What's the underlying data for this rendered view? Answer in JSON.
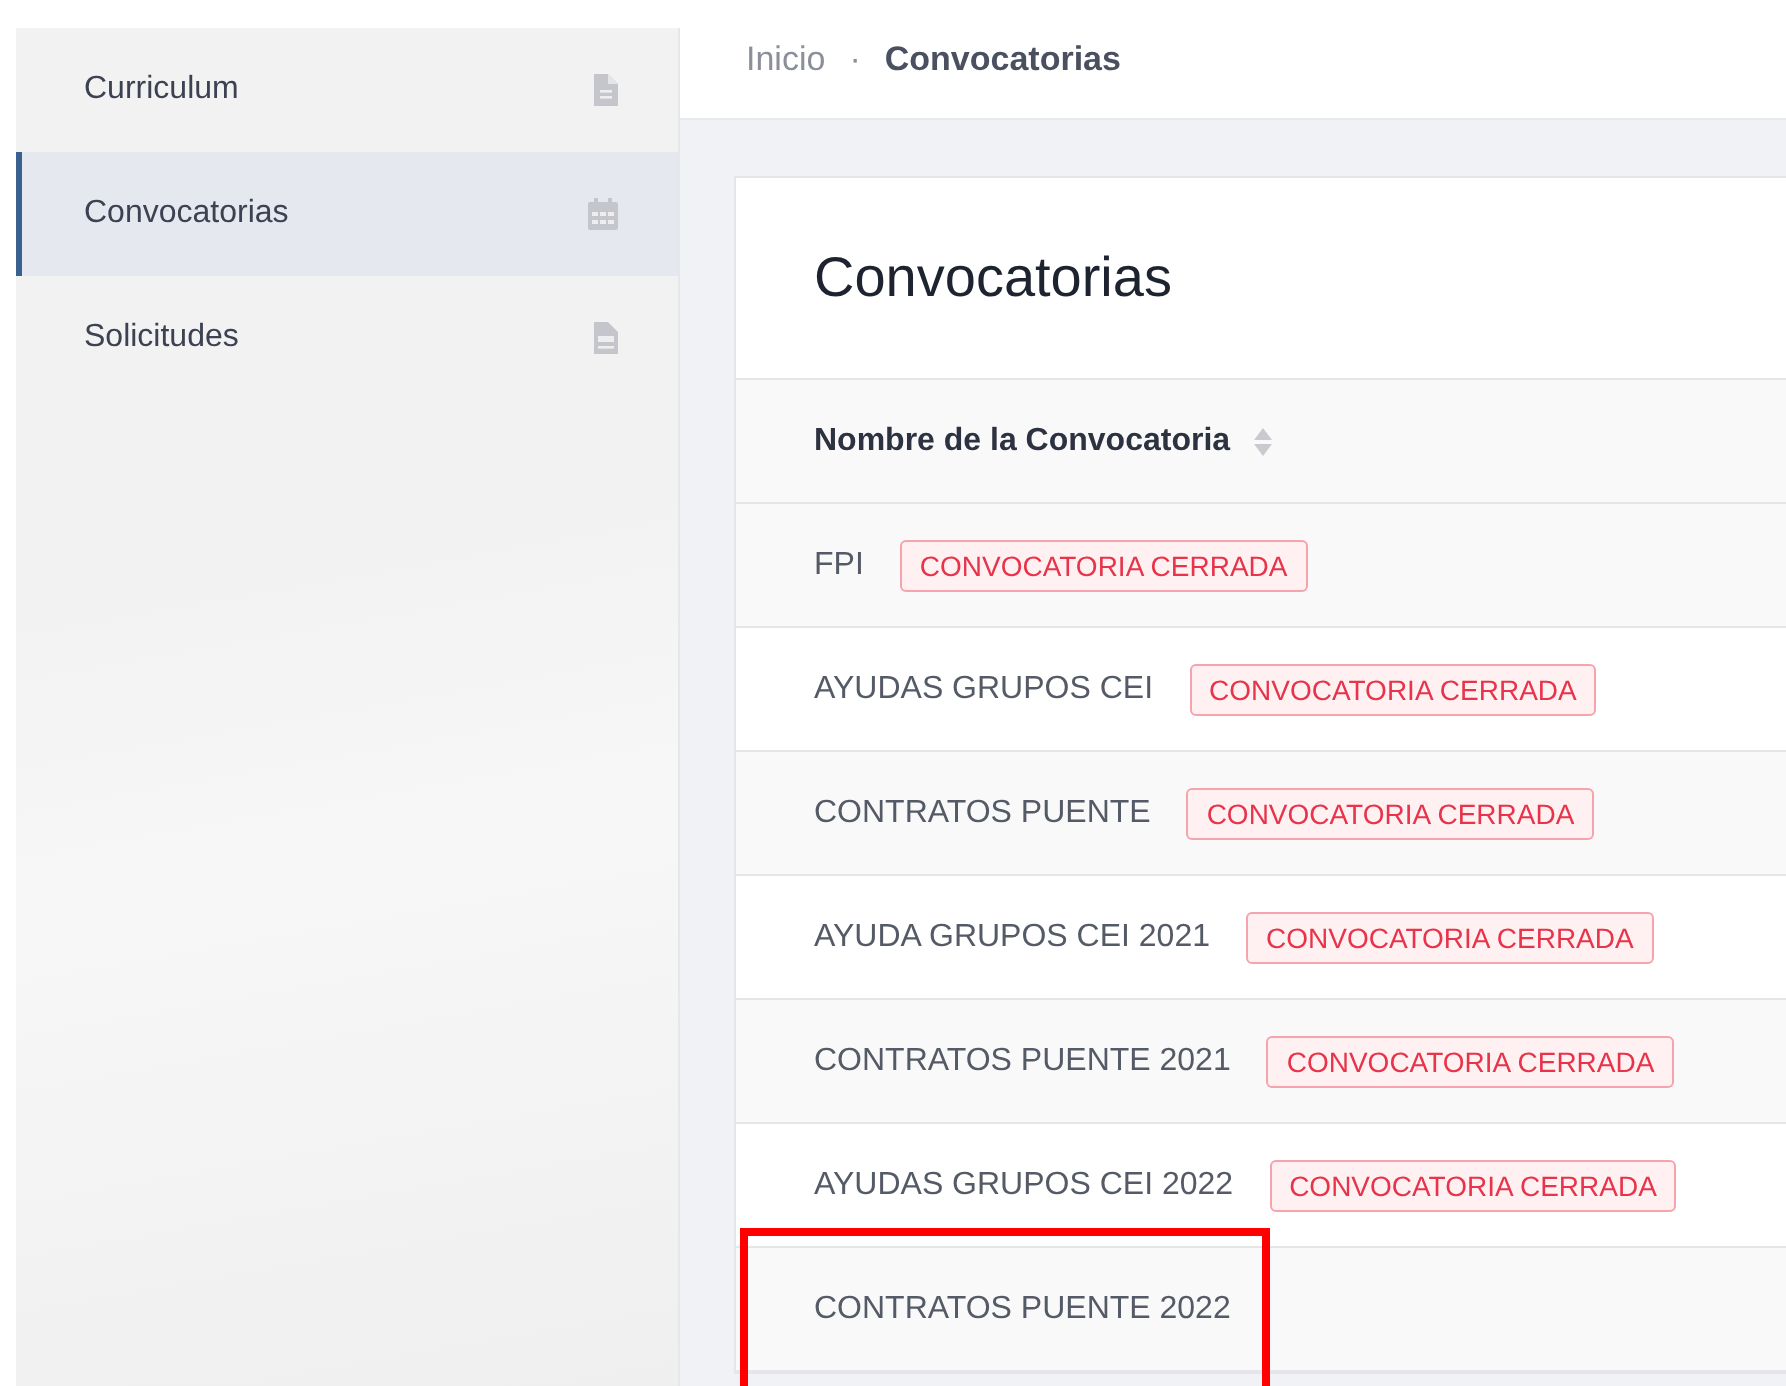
{
  "sidebar": {
    "items": [
      {
        "label": "Curriculum",
        "kind": "document",
        "selected": false
      },
      {
        "label": "Convocatorias",
        "kind": "calendar",
        "selected": true
      },
      {
        "label": "Solicitudes",
        "kind": "form",
        "selected": false
      }
    ]
  },
  "breadcrumb": [
    {
      "label": "Inicio",
      "current": false
    },
    {
      "label": "Convocatorias",
      "current": true
    }
  ],
  "breadcrumb_separator": "·",
  "card": {
    "title": "Convocatorias",
    "table": {
      "columns": [
        {
          "label": "Nombre de la Convocatoria",
          "sortable": true
        }
      ],
      "rows": [
        {
          "name": "FPI",
          "badge": "CONVOCATORIA CERRADA",
          "highlighted": false
        },
        {
          "name": "AYUDAS GRUPOS CEI",
          "badge": "CONVOCATORIA CERRADA",
          "highlighted": false
        },
        {
          "name": "CONTRATOS PUENTE",
          "badge": "CONVOCATORIA CERRADA",
          "highlighted": false
        },
        {
          "name": "AYUDA GRUPOS CEI 2021",
          "badge": "CONVOCATORIA CERRADA",
          "highlighted": false
        },
        {
          "name": "CONTRATOS PUENTE 2021",
          "badge": "CONVOCATORIA CERRADA",
          "highlighted": false
        },
        {
          "name": "AYUDAS GRUPOS CEI 2022",
          "badge": "CONVOCATORIA CERRADA",
          "highlighted": false
        },
        {
          "name": "CONTRATOS PUENTE 2022",
          "highlighted": true
        }
      ]
    }
  }
}
